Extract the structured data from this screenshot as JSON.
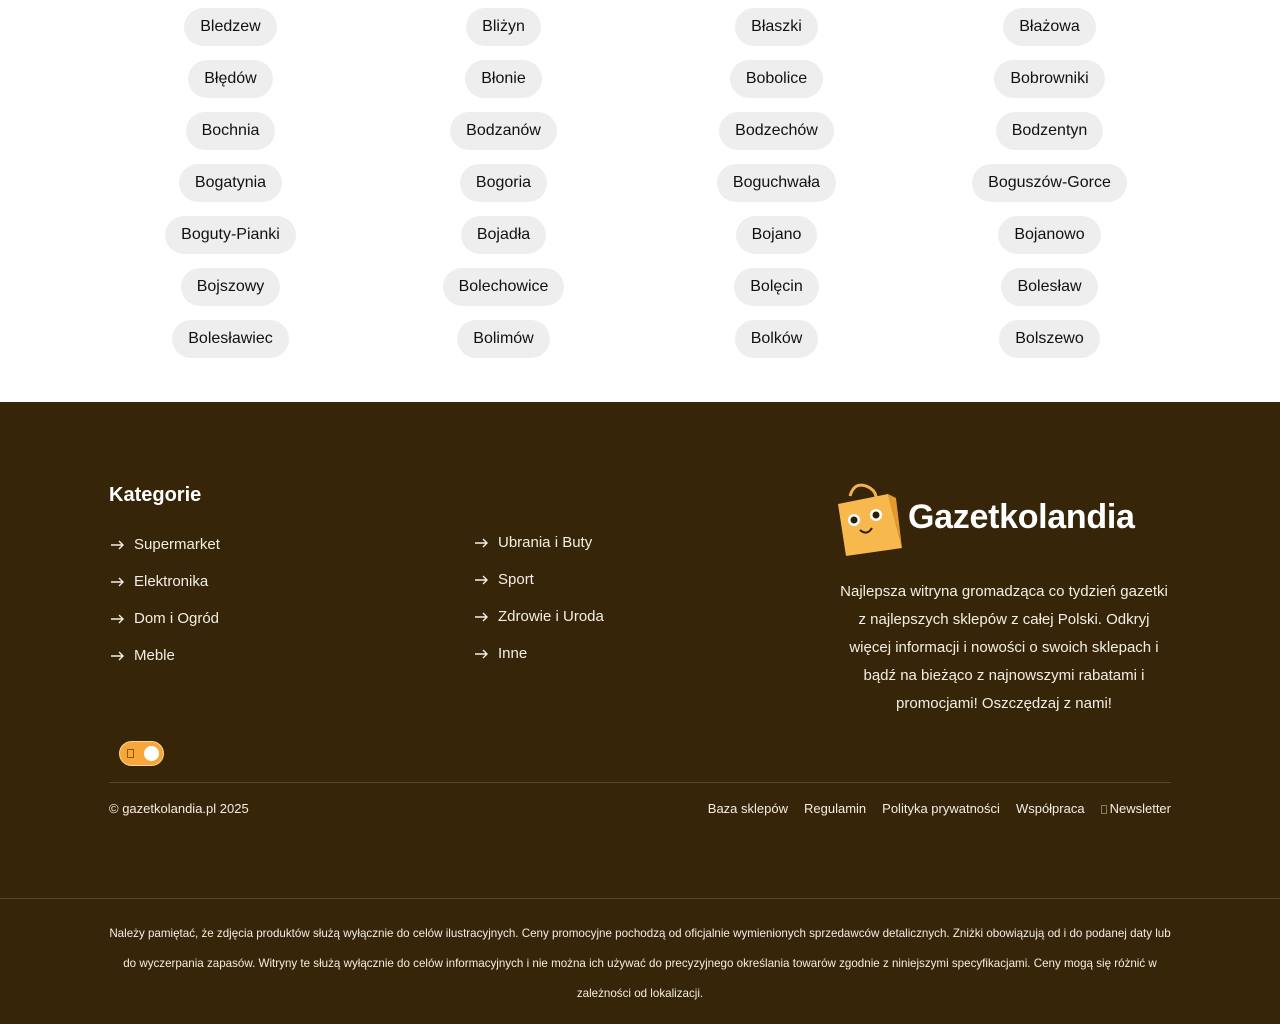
{
  "cities": [
    "Bledzew",
    "Bliżyn",
    "Błaszki",
    "Błażowa",
    "Błędów",
    "Błonie",
    "Bobolice",
    "Bobrowniki",
    "Bochnia",
    "Bodzanów",
    "Bodzechów",
    "Bodzentyn",
    "Bogatynia",
    "Bogoria",
    "Boguchwała",
    "Boguszów-Gorce",
    "Boguty-Pianki",
    "Bojadła",
    "Bojano",
    "Bojanowo",
    "Bojszowy",
    "Bolechowice",
    "Bolęcin",
    "Bolesław",
    "Bolesławiec",
    "Bolimów",
    "Bolków",
    "Bolszewo"
  ],
  "footer": {
    "categories_title": "Kategorie",
    "categories_col1": [
      "Supermarket",
      "Elektronika",
      "Dom i Ogród",
      "Meble"
    ],
    "categories_col2": [
      "Ubrania i Buty",
      "Sport",
      "Zdrowie i Uroda",
      "Inne"
    ],
    "brand_name": "Gazetkolandia",
    "brand_description": "Najlepsza witryna gromadząca co tydzień gazetki z najlepszych sklepów z całej Polski. Odkryj więcej informacji i nowości o swoich sklepach i bądź na bieżąco z najnowszymi rabatami i promocjami! Oszczędzaj z nami!",
    "copyright": "© gazetkolandia.pl 2025",
    "links": [
      "Baza sklepów",
      "Regulamin",
      "Polityka prywatności",
      "Współpraca"
    ],
    "newsletter_label": "Newsletter",
    "disclaimer": "Należy pamiętać, że zdjęcia produktów służą wyłącznie do celów ilustracyjnych. Ceny promocyjne pochodzą od oficjalnie wymienionych sprzedawców detalicznych. Zniżki obowiązują od i do podanej daty lub do wyczerpania zapasów. Witryny te służą wyłącznie do celów informacyjnych i nie można ich używać do precyzyjnego określania towarów zgodnie z niniejszymi specyfikacjami. Ceny mogą się różnić w zależności od lokalizacji."
  },
  "theme_toggle": {
    "state": "on"
  },
  "colors": {
    "footer_bg": "#362508",
    "pill_bg": "#eeeeee",
    "accent": "#f7a63a"
  },
  "icons": {
    "category_link": "arrow-right-icon",
    "toggle": "sun-icon",
    "newsletter": "mail-icon",
    "logo": "shopping-bag-mascot-icon"
  }
}
